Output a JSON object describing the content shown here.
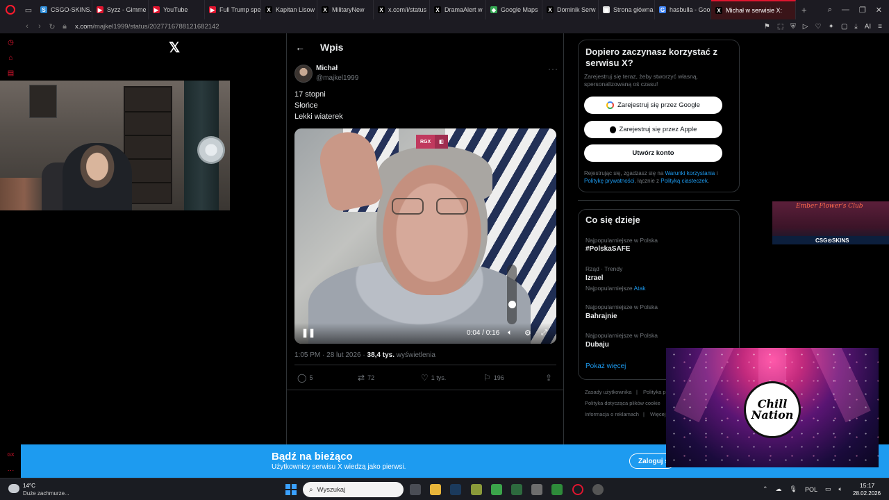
{
  "browser": {
    "tabs": [
      {
        "label": "CSGO-SKINS.",
        "color": "#2e8bd6",
        "glyph": "S"
      },
      {
        "label": "Syzz - Gimme",
        "color": "#e0152f",
        "glyph": "▶"
      },
      {
        "label": "YouTube",
        "color": "#e0152f",
        "glyph": "▶"
      },
      {
        "label": "Full Trump spe",
        "color": "#e0152f",
        "glyph": "▶"
      },
      {
        "label": "Kapitan Lisow",
        "color": "#000000",
        "glyph": "X"
      },
      {
        "label": "MilitaryNew",
        "color": "#000000",
        "glyph": "X"
      },
      {
        "label": "x.com/i/status",
        "color": "#000000",
        "glyph": "X"
      },
      {
        "label": "DramaAlert w",
        "color": "#000000",
        "glyph": "X"
      },
      {
        "label": "Google Maps",
        "color": "#34a853",
        "glyph": "◆"
      },
      {
        "label": "Dominik Serw",
        "color": "#000000",
        "glyph": "X"
      },
      {
        "label": "Strona główna",
        "color": "#dddddd",
        "glyph": "▣"
      },
      {
        "label": "hasbulla - Goo",
        "color": "#4285f4",
        "glyph": "G"
      },
      {
        "label": "Michał w serwisie X:",
        "color": "#000000",
        "glyph": "X",
        "active": true
      }
    ],
    "url_host": "x.com",
    "url_path": "/majkel1999/status/2027716788121682142"
  },
  "x_logo": "𝕏",
  "post": {
    "header_title": "Wpis",
    "author_name": "Michał",
    "author_handle": "@majkel1999",
    "more": "···",
    "lines": [
      "17 stopni",
      "Słońce",
      "Lekki wiaterek"
    ],
    "video": {
      "badge_left": "RGX",
      "badge_right": "◧",
      "time": "0:04 / 0:16",
      "volume_level": 0.35
    },
    "meta": {
      "time": "1:05 PM · 28 lut 2026 · ",
      "views": "38,4 tys.",
      "views_label": " wyświetlenia"
    },
    "actions": {
      "replies": "5",
      "reposts": "72",
      "likes": "1 tys.",
      "bookmarks": "196"
    }
  },
  "signup": {
    "title": "Dopiero zaczynasz korzystać z serwisu X?",
    "subtitle": "Zarejestruj się teraz, żeby stworzyć własną, spersonalizowaną oś czasu!",
    "google": "Zarejestruj się przez Google",
    "apple": "Zarejestruj się przez Apple",
    "create": "Utwórz konto",
    "terms_1": "Rejestrując się, zgadzasz się na ",
    "terms_link1": "Warunki korzystania",
    "terms_2": " i ",
    "terms_link2": "Politykę prywatności",
    "terms_3": ", łącznie z ",
    "terms_link3": "Polityką ciasteczek",
    "terms_4": "."
  },
  "trending": {
    "title": "Co się dzieje",
    "items": [
      {
        "context": "Najpopularniejsze w Polska",
        "name": "#PolskaSAFE",
        "sub": "",
        "sub_link": ""
      },
      {
        "context": "Rząd · Trendy",
        "name": "Izrael",
        "sub": "Najpopularniejsze ",
        "sub_link": "Atak"
      },
      {
        "context": "Najpopularniejsze w Polska",
        "name": "Bahrajnie",
        "sub": "",
        "sub_link": ""
      },
      {
        "context": "Najpopularniejsze w Polska",
        "name": "Dubaju",
        "sub": "",
        "sub_link": ""
      }
    ],
    "show_more": "Pokaż więcej"
  },
  "footer": {
    "links": [
      "Zasady użytkownika",
      "|",
      "Polityka p",
      "Polityka dotycząca plików cookie",
      "Informacja o reklamach",
      "|",
      "Więcej"
    ]
  },
  "csgo_banner": {
    "sign": "Ember Flower's Club",
    "brand": "CSG⊙SKINS"
  },
  "chill_logo": {
    "line1": "Chill",
    "line2": "Nation"
  },
  "banner": {
    "title": "Bądź na bieżąco",
    "subtitle": "Użytkownicy serwisu X wiedzą jako pierwsi.",
    "login": "Zaloguj s"
  },
  "taskbar": {
    "temp": "14°C",
    "weather": "Duże zachmurze...",
    "search": "Wyszukaj",
    "lang": "POL",
    "time": "15:17",
    "date": "28.02.2026"
  },
  "colors": {
    "x_blue": "#1d9bf0",
    "opera_red": "#e0152f"
  }
}
